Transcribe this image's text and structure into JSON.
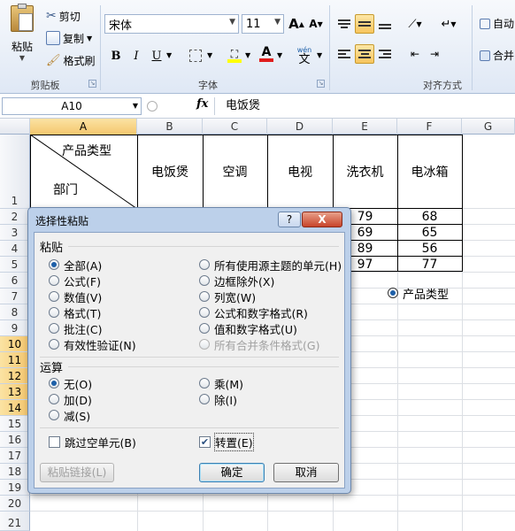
{
  "ribbon": {
    "clipboard": {
      "paste_label": "粘贴",
      "cut_label": "剪切",
      "copy_label": "复制",
      "format_painter_label": "格式刷",
      "group_label": "剪贴板"
    },
    "font": {
      "font_name": "宋体",
      "font_size": "11",
      "grow_label": "A",
      "shrink_label": "A",
      "bold": "B",
      "italic": "I",
      "underline": "U",
      "font_color_letter": "A",
      "phonetic_label": "wén",
      "phonetic_char": "文",
      "group_label": "字体"
    },
    "alignment": {
      "wrap_label": "自动",
      "merge_label": "合并",
      "group_label": "对齐方式"
    }
  },
  "formula_bar": {
    "name_box": "A10",
    "fx_label": "fx",
    "content": "电饭煲"
  },
  "grid": {
    "columns": [
      "A",
      "B",
      "C",
      "D",
      "E",
      "F",
      "G"
    ],
    "selected_column": "A",
    "rows": [
      "1",
      "2",
      "3",
      "4",
      "5",
      "6",
      "7",
      "8",
      "9",
      "10",
      "11",
      "12",
      "13",
      "14",
      "15",
      "16",
      "17",
      "18",
      "19",
      "20",
      "21"
    ],
    "selected_rows": [
      "10",
      "11",
      "12",
      "13",
      "14"
    ],
    "header_diag_top": "产品类型",
    "header_diag_bottom": "部门",
    "products": [
      "电饭煲",
      "空调",
      "电视",
      "洗衣机",
      "电冰箱"
    ],
    "col_e_values": [
      "79",
      "69",
      "89",
      "97"
    ],
    "col_f_values": [
      "68",
      "65",
      "56",
      "77"
    ],
    "radio_label": "产品类型"
  },
  "dialog": {
    "title": "选择性粘贴",
    "help_label": "?",
    "close_label": "X",
    "paste_section": "粘贴",
    "paste_options_left": [
      "全部(A)",
      "公式(F)",
      "数值(V)",
      "格式(T)",
      "批注(C)",
      "有效性验证(N)"
    ],
    "paste_options_right": [
      "所有使用源主题的单元(H)",
      "边框除外(X)",
      "列宽(W)",
      "公式和数字格式(R)",
      "值和数字格式(U)",
      "所有合并条件格式(G)"
    ],
    "operation_section": "运算",
    "operation_left": [
      "无(O)",
      "加(D)",
      "减(S)"
    ],
    "operation_right": [
      "乘(M)",
      "除(I)"
    ],
    "skip_blanks_label": "跳过空单元(B)",
    "transpose_label": "转置(E)",
    "paste_link_label": "粘贴链接(L)",
    "ok_label": "确定",
    "cancel_label": "取消"
  }
}
